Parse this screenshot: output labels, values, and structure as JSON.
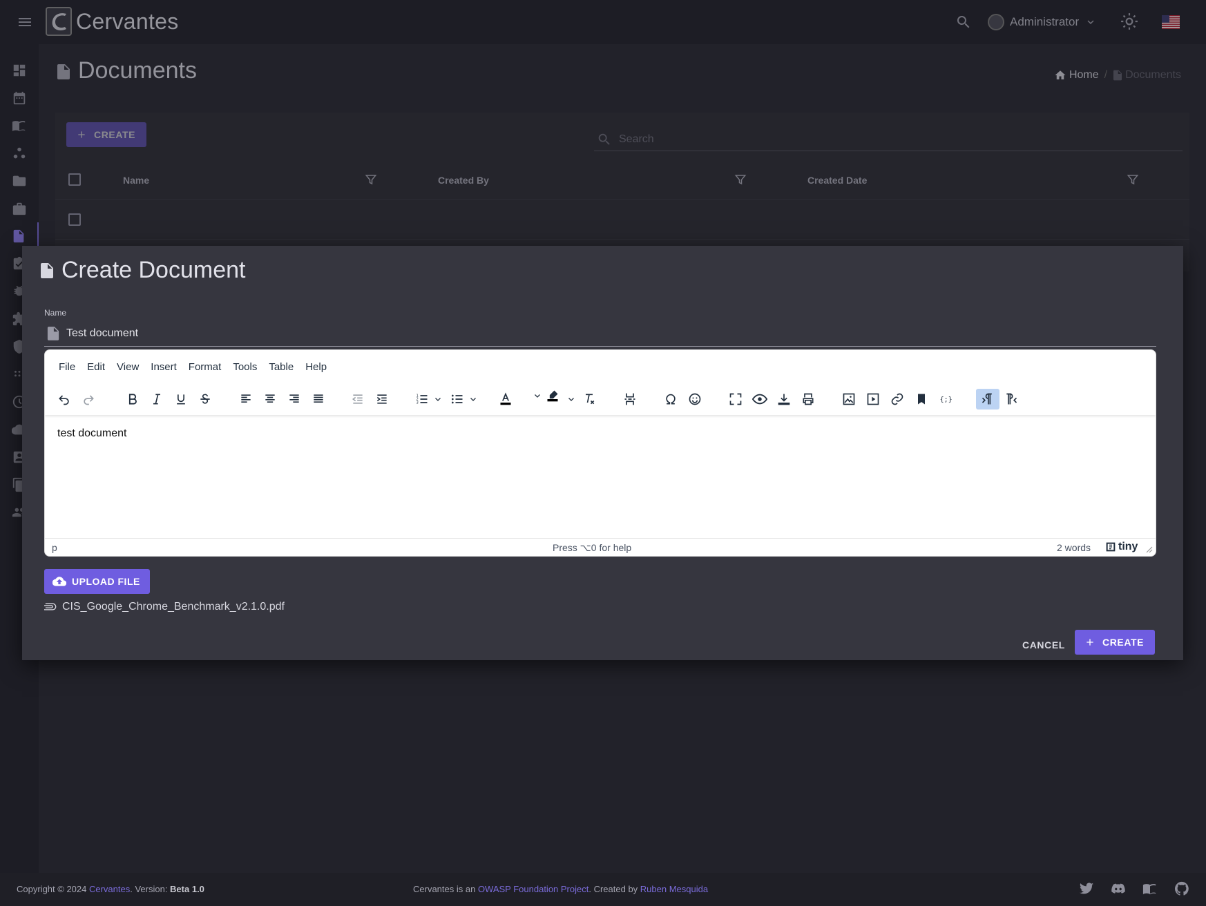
{
  "app": {
    "name": "Cervantes",
    "user_name": "Administrator"
  },
  "page": {
    "title": "Documents",
    "breadcrumb": {
      "home": "Home",
      "current": "Documents"
    }
  },
  "table": {
    "create_label": "CREATE",
    "search_placeholder": "Search",
    "columns": [
      "Name",
      "Created By",
      "Created Date"
    ]
  },
  "dialog": {
    "title": "Create Document",
    "name_label": "Name",
    "name_value": "Test document",
    "editor": {
      "menus": [
        "File",
        "Edit",
        "View",
        "Insert",
        "Format",
        "Tools",
        "Table",
        "Help"
      ],
      "content": "test document",
      "status_path": "p",
      "status_help": "Press ⌥0 for help",
      "word_count": "2 words",
      "brand": "tiny"
    },
    "upload_label": "UPLOAD FILE",
    "attachment_name": "CIS_Google_Chrome_Benchmark_v2.1.0.pdf",
    "cancel_label": "CANCEL",
    "create_label": "CREATE"
  },
  "footer": {
    "copyright_prefix": "Copyright © 2024 ",
    "app_link": "Cervantes",
    "version_prefix": ". Version: ",
    "version": "Beta 1.0",
    "owasp_prefix": "Cervantes is an ",
    "owasp_link": "OWASP Foundation Project",
    "created_by_prefix": ". Created by ",
    "author_link": "Ruben Mesquida"
  },
  "colors": {
    "accent": "#6f5de0",
    "background": "#2a2a33",
    "topbar": "#23232b"
  }
}
